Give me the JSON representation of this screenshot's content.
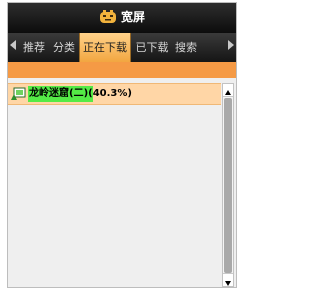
{
  "app": {
    "title": "宽屏",
    "icon": "app-face-icon"
  },
  "tabs": [
    {
      "label": "推荐",
      "active": false
    },
    {
      "label": "分类",
      "active": false
    },
    {
      "label": "正在下载",
      "active": true
    },
    {
      "label": "已下载",
      "active": false
    },
    {
      "label": "搜索",
      "active": false
    }
  ],
  "downloads": [
    {
      "title": "龙岭迷窟(二)",
      "progress_text": "(40.3%)",
      "progress": 0.403,
      "icon": "video-file-icon"
    }
  ],
  "colors": {
    "accent": "#f59a45",
    "active_tab": "#f2a640",
    "row_bg": "#ffd6a6",
    "highlight": "#54ea46"
  },
  "icons": {
    "tab_prev": "tab-left-arrow-icon",
    "tab_next": "tab-right-arrow-icon",
    "scroll_up": "scroll-up-arrow-icon",
    "scroll_down": "scroll-down-arrow-icon"
  }
}
